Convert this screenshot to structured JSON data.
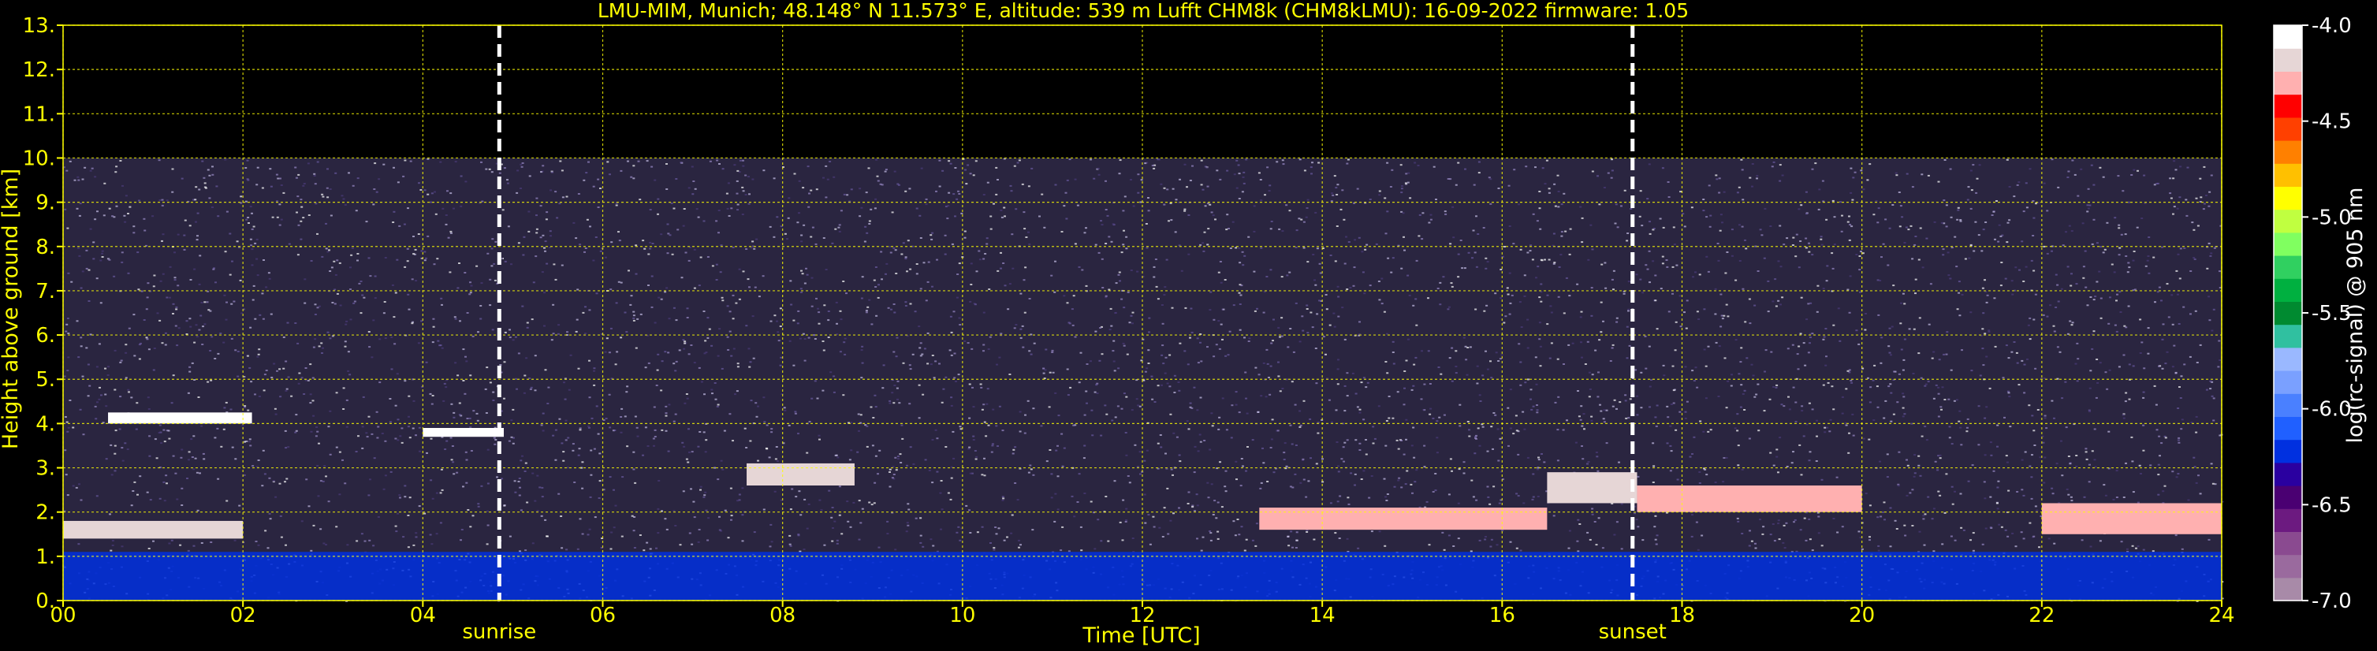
{
  "chart_data": {
    "type": "heatmap",
    "title": "LMU-MIM, Munich; 48.148° N 11.573° E, altitude: 539 m    Lufft CHM8k (CHM8kLMU): 16-09-2022    firmware: 1.05",
    "xlabel": "Time [UTC]",
    "ylabel": "Height above ground [km]",
    "xlim": [
      0,
      24
    ],
    "ylim": [
      0,
      13
    ],
    "x_ticks": [
      0,
      2,
      4,
      6,
      8,
      10,
      12,
      14,
      16,
      18,
      20,
      22,
      24
    ],
    "x_tick_labels": [
      "00",
      "02",
      "04",
      "06",
      "08",
      "10",
      "12",
      "14",
      "16",
      "18",
      "20",
      "22",
      "24"
    ],
    "y_ticks": [
      0,
      1,
      2,
      3,
      4,
      5,
      6,
      7,
      8,
      9,
      10,
      11,
      12,
      13
    ],
    "y_tick_labels": [
      "0.",
      "1.",
      "2.",
      "3.",
      "4.",
      "5.",
      "6.",
      "7.",
      "8.",
      "9.",
      "10.",
      "11.",
      "12.",
      "13."
    ],
    "grid": true,
    "data_top_km": 10,
    "events": [
      {
        "label": "sunrise",
        "time": 4.85
      },
      {
        "label": "sunset",
        "time": 17.45
      }
    ],
    "colorbar": {
      "label": "log(rc-signal) @ 905 nm",
      "range": [
        -7.0,
        -4.0
      ],
      "ticks": [
        -4.0,
        -4.5,
        -5.0,
        -5.5,
        -6.0,
        -6.5,
        -7.0
      ],
      "tick_labels": [
        "-4.0",
        "-4.5",
        "-5.0",
        "-5.5",
        "-6.0",
        "-6.5",
        "-7.0"
      ],
      "colors": [
        "#a88aa8",
        "#9a6a9e",
        "#8a4a90",
        "#6c1a80",
        "#4a0072",
        "#2a00a0",
        "#0030e0",
        "#2060ff",
        "#4a80ff",
        "#7aa0ff",
        "#9ab8ff",
        "#30c0a0",
        "#008a30",
        "#00b040",
        "#30d060",
        "#80ff60",
        "#c0ff40",
        "#ffff00",
        "#ffc000",
        "#ff8000",
        "#ff4000",
        "#ff0000",
        "#ffb0b0",
        "#e6d6d6",
        "#ffffff"
      ]
    },
    "layers": [
      {
        "time": [
          0,
          2
        ],
        "height": [
          1.4,
          1.8
        ],
        "level": -4.2
      },
      {
        "time": [
          0.5,
          2.1
        ],
        "height": [
          4.0,
          4.25
        ],
        "level": -4.1
      },
      {
        "time": [
          4.0,
          4.9
        ],
        "height": [
          3.7,
          3.9
        ],
        "level": -4.1
      },
      {
        "time": [
          7.6,
          8.8
        ],
        "height": [
          2.6,
          3.1
        ],
        "level": -4.2
      },
      {
        "time": [
          13.3,
          16.5
        ],
        "height": [
          1.6,
          2.1
        ],
        "level": -4.3
      },
      {
        "time": [
          16.5,
          17.5
        ],
        "height": [
          2.2,
          2.9
        ],
        "level": -4.2
      },
      {
        "time": [
          17.5,
          20.0
        ],
        "height": [
          2.0,
          2.6
        ],
        "level": -4.3
      },
      {
        "time": [
          22.0,
          24.0
        ],
        "height": [
          1.5,
          2.2
        ],
        "level": -4.3
      }
    ],
    "boundary_layer": {
      "top_km": 1.1,
      "level": -6.2
    }
  }
}
